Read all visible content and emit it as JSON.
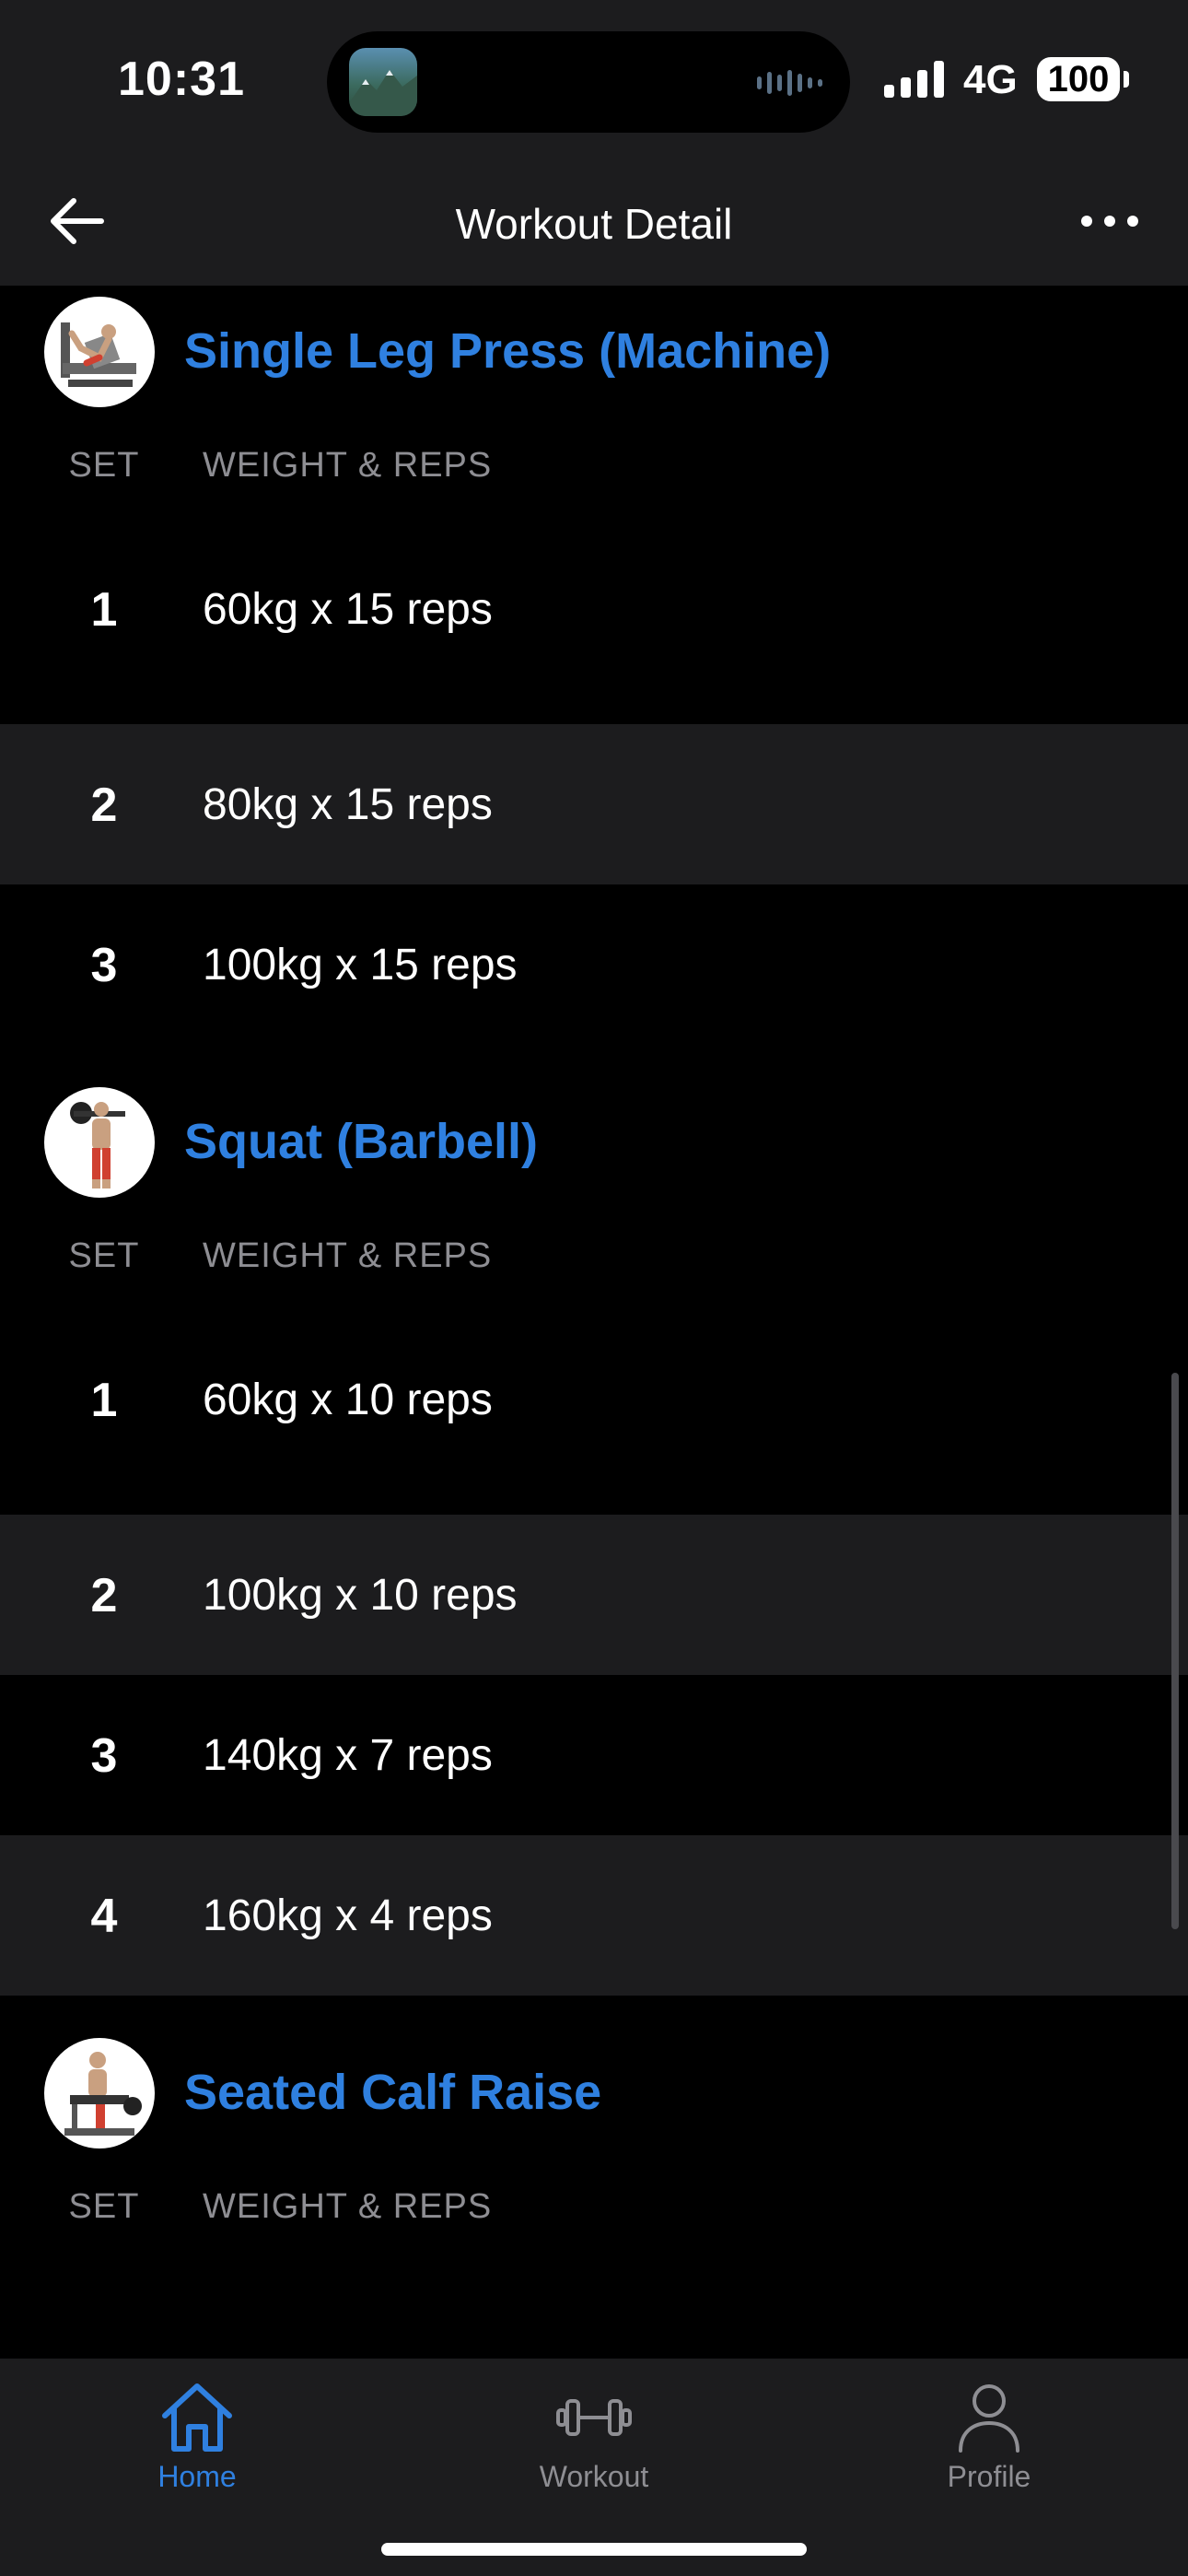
{
  "status_bar": {
    "time": "10:31",
    "network": "4G",
    "battery": "100"
  },
  "nav": {
    "title": "Workout Detail",
    "back_icon": "arrow-left-icon",
    "more_icon": "ellipsis-icon"
  },
  "columns": {
    "set": "SET",
    "weight_reps": "WEIGHT & REPS"
  },
  "exercises": [
    {
      "name": "Single Leg Press (Machine)",
      "sets": [
        {
          "number": "1",
          "value": "60kg x 15 reps"
        },
        {
          "number": "2",
          "value": "80kg x 15 reps"
        },
        {
          "number": "3",
          "value": "100kg x 15 reps"
        }
      ]
    },
    {
      "name": "Squat (Barbell)",
      "sets": [
        {
          "number": "1",
          "value": "60kg x 10 reps"
        },
        {
          "number": "2",
          "value": "100kg x 10 reps"
        },
        {
          "number": "3",
          "value": "140kg x 7 reps"
        },
        {
          "number": "4",
          "value": "160kg x 4 reps"
        }
      ]
    },
    {
      "name": "Seated Calf Raise",
      "sets": []
    }
  ],
  "tabs": [
    {
      "label": "Home",
      "icon": "home-icon",
      "active": true
    },
    {
      "label": "Workout",
      "icon": "dumbbell-icon",
      "active": false
    },
    {
      "label": "Profile",
      "icon": "person-icon",
      "active": false
    }
  ],
  "colors": {
    "accent": "#2f80e0",
    "background": "#000000",
    "surface": "#1c1c1e",
    "muted": "#8e8e93"
  }
}
